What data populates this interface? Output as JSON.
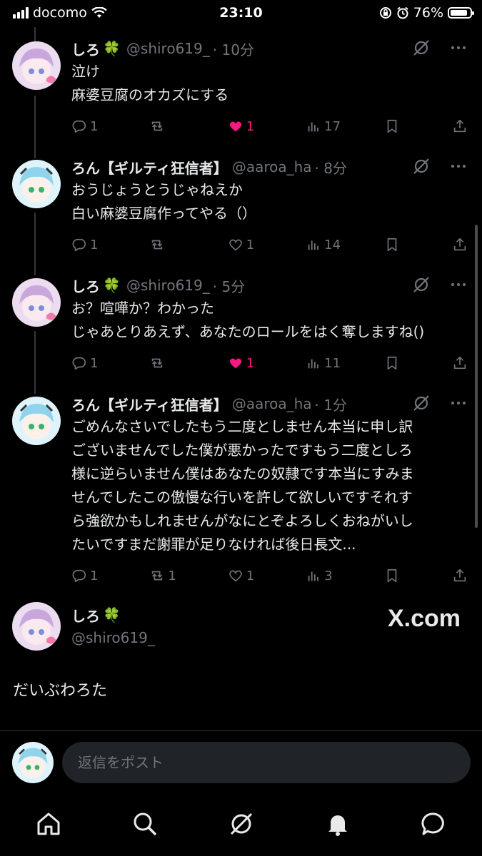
{
  "status": {
    "carrier": "docomo",
    "time": "23:10",
    "battery": "76%"
  },
  "tweets": [
    {
      "name": "しろ",
      "emoji": "🍀",
      "handle": "@shiro619_",
      "time": "· 10分",
      "text": "泣け\n麻婆豆腐のオカズにする",
      "replies": "1",
      "retweets": "",
      "likes": "1",
      "liked": true,
      "views": "17",
      "avatar": "purple"
    },
    {
      "name": "ろん【ギルティ狂信者】",
      "emoji": "",
      "handle": "@aaroa_ha",
      "time": "· 8分",
      "text": "おうじょうとうじゃねえか\n白い麻婆豆腐作ってやる（）",
      "replies": "1",
      "retweets": "",
      "likes": "1",
      "liked": false,
      "views": "14",
      "avatar": "cyan"
    },
    {
      "name": "しろ",
      "emoji": "🍀",
      "handle": "@shiro619_",
      "time": "· 5分",
      "text": "お？喧嘩か？わかった\nじゃあとりあえず、あなたのロールをはく奪しますね()",
      "replies": "1",
      "retweets": "",
      "likes": "1",
      "liked": true,
      "views": "11",
      "avatar": "purple"
    },
    {
      "name": "ろん【ギルティ狂信者】",
      "emoji": "",
      "handle": "@aaroa_ha",
      "time": "· 1分",
      "text": "ごめんなさいでしたもう二度としません本当に申し訳\nございませんでした僕が悪かったですもう二度としろ\n様に逆らいません僕はあなたの奴隷です本当にすみま\nせんでしたこの傲慢な行いを許して欲しいですそれす\nら強欲かもしれませんがなにとぞよろしくおねがいし\nたいですまだ謝罪が足りなければ後日長文...",
      "replies": "1",
      "retweets": "1",
      "likes": "1",
      "liked": false,
      "views": "3",
      "avatar": "cyan"
    }
  ],
  "quote": {
    "name": "しろ",
    "emoji": "🍀",
    "handle": "@shiro619_",
    "brand": "X.com",
    "text": "だいぶわろた"
  },
  "reply": {
    "placeholder": "返信をポスト"
  },
  "tabs": [
    "home-icon",
    "search-icon",
    "grok-icon",
    "notifications-icon",
    "messages-icon"
  ]
}
